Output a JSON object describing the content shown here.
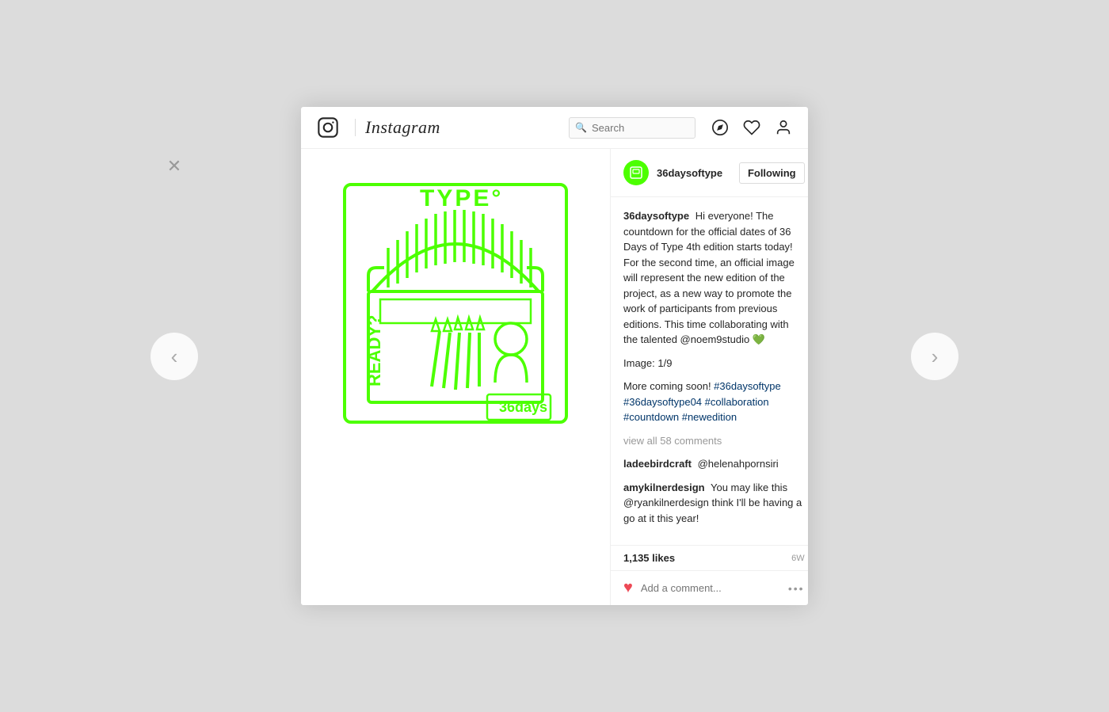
{
  "page": {
    "background": "#e8e8e8"
  },
  "header": {
    "logo_alt": "Instagram",
    "wordmark": "Instagram",
    "search_placeholder": "Search",
    "nav_icon_compass": "compass",
    "nav_icon_heart": "heart",
    "nav_icon_profile": "profile"
  },
  "post": {
    "username": "36daysoftype",
    "following_label": "Following",
    "likes": "1,135 likes",
    "timestamp": "6w",
    "caption_username": "36daysoftype",
    "caption_text": " Hi everyone! The countdown for the official dates of 36 Days of Type 4th edition starts today! For the second time, an official image will represent the new edition of the project, as a new way to promote the work of participants from previous editions. This time collaborating with the talented @noem9studio 💚",
    "caption_image_ref": "Image: 1/9",
    "hashtags": "#36daysoftype #36daysoftype04 #collaboration #countdown #newedition",
    "more_text": "More coming soon! #36daysoftype #36daysoftype04 #collaboration #countdown #newedition",
    "view_comments": "view all 58 comments",
    "comment1_user": "ladeebirdcraft",
    "comment1_text": "@helenahpornsiri",
    "comment2_user": "amykilnerdesign",
    "comment2_text": "You may like this @ryankilnerdesign think I'll be having a go at it this year!",
    "add_comment_placeholder": "Add a comment...",
    "image_alt": "36 days of type typewriter illustration",
    "accent_color": "#4cff00"
  },
  "navigation": {
    "prev_label": "‹",
    "next_label": "›",
    "close_label": "✕"
  }
}
